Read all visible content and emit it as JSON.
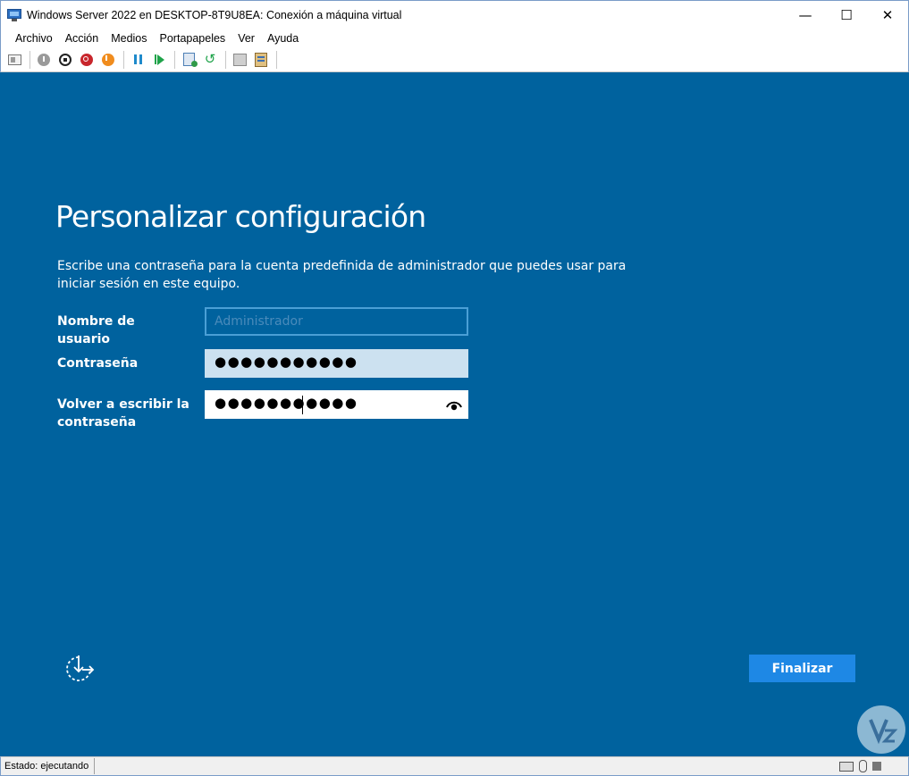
{
  "window": {
    "title": "Windows Server 2022 en DESKTOP-8T9U8EA: Conexión a máquina virtual",
    "minimize_glyph": "—",
    "maximize_glyph": "☐",
    "close_glyph": "✕"
  },
  "menu": {
    "items": [
      "Archivo",
      "Acción",
      "Medios",
      "Portapapeles",
      "Ver",
      "Ayuda"
    ]
  },
  "toolbar": {
    "icons": [
      "ctrl-alt-del-icon",
      "start-icon",
      "turn-off-icon",
      "shut-down-icon",
      "save-state-icon",
      "pause-icon",
      "resume-icon",
      "checkpoint-icon",
      "revert-icon",
      "enhanced-session-icon",
      "share-icon"
    ]
  },
  "setup": {
    "title": "Personalizar configuración",
    "description": "Escribe una contraseña para la cuenta predefinida de administrador que puedes usar para iniciar sesión en este equipo.",
    "username_label": "Nombre de usuario",
    "username_placeholder": "Administrador",
    "password_label": "Contraseña",
    "password_value": "●●●●●●●●●●●",
    "confirm_label": "Volver a escribir la contraseña",
    "confirm_value": "●●●●●●●●●●●",
    "finish_label": "Finalizar"
  },
  "status": {
    "text": "Estado: ejecutando"
  },
  "colors": {
    "background": "#00629e",
    "button": "#1e88e5",
    "password_field": "#cce1f0"
  }
}
